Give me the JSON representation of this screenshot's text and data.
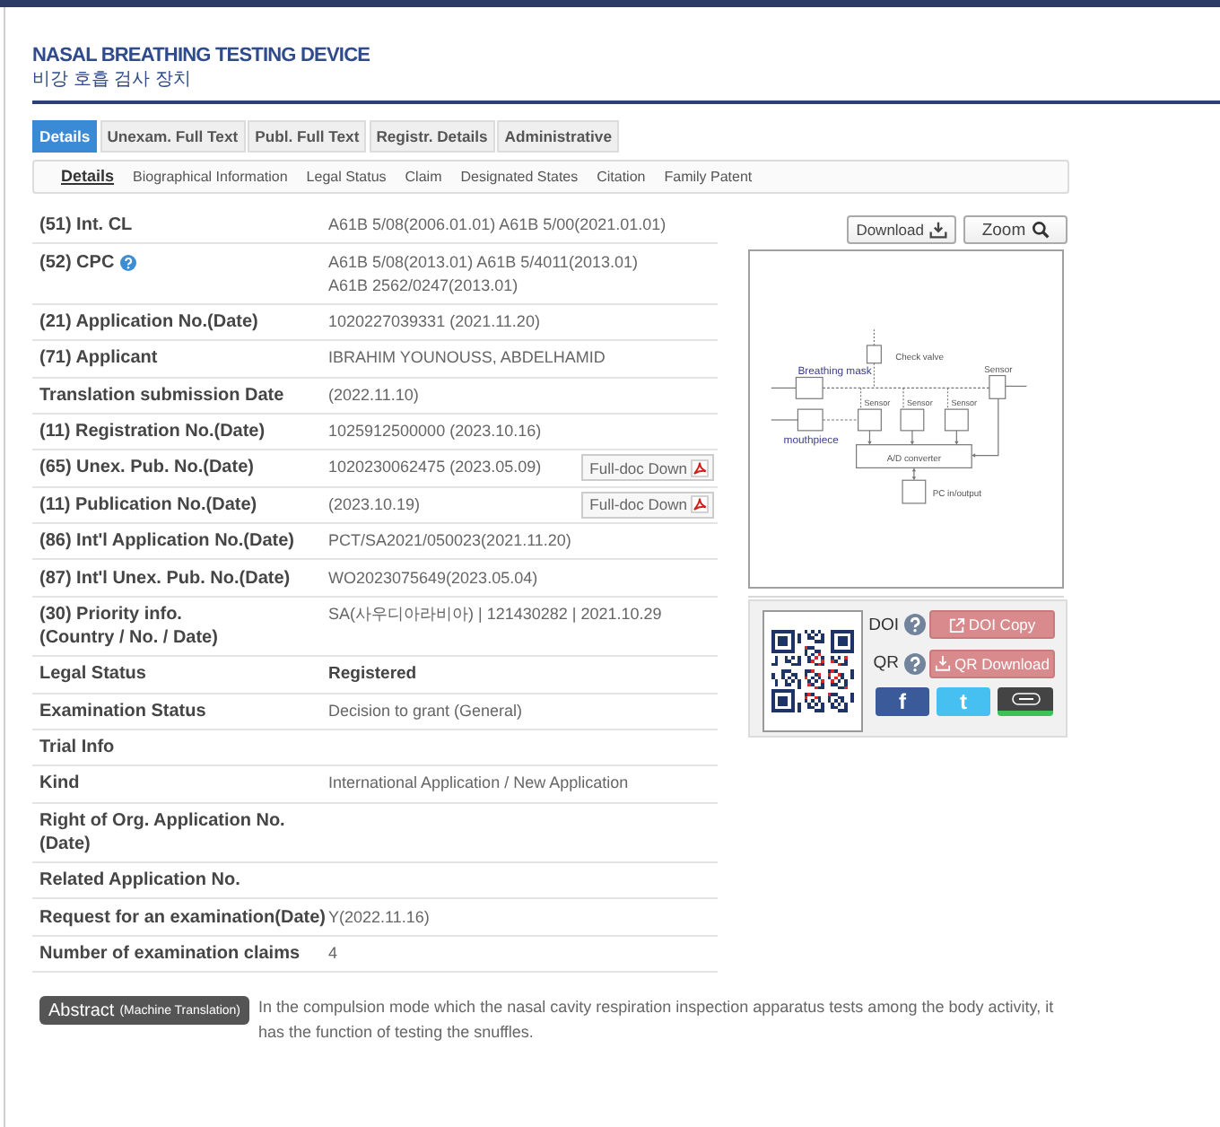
{
  "header": {
    "title": "NASAL BREATHING TESTING DEVICE",
    "subtitle": "비강 호흡 검사 장치"
  },
  "tabs": [
    {
      "label": "Details",
      "selected": true
    },
    {
      "label": "Unexam. Full Text",
      "selected": false
    },
    {
      "label": "Publ. Full Text",
      "selected": false
    },
    {
      "label": "Registr. Details",
      "selected": false
    },
    {
      "label": "Administrative",
      "selected": false
    }
  ],
  "subtabs": [
    {
      "label": "Details",
      "selected": true
    },
    {
      "label": "Biographical Information",
      "selected": false
    },
    {
      "label": "Legal Status",
      "selected": false
    },
    {
      "label": "Claim",
      "selected": false
    },
    {
      "label": "Designated States",
      "selected": false
    },
    {
      "label": "Citation",
      "selected": false
    },
    {
      "label": "Family Patent",
      "selected": false
    }
  ],
  "fields": [
    {
      "kind": "plain",
      "label": "(51) Int. CL",
      "value": "A61B 5/08(2006.01.01) A61B 5/00(2021.01.01)"
    },
    {
      "kind": "help",
      "label": "(52) CPC",
      "value": "A61B 5/08(2013.01) A61B 5/4011(2013.01)\nA61B 2562/0247(2013.01)"
    },
    {
      "kind": "plain",
      "label": "(21) Application No.(Date)",
      "value": "1020227039331 (2021.11.20)"
    },
    {
      "kind": "plain",
      "label": "(71) Applicant",
      "value": "IBRAHIM YOUNOUSS, ABDELHAMID"
    },
    {
      "kind": "plain",
      "label": "Translation submission Date",
      "value": "(2022.11.10)"
    },
    {
      "kind": "plain",
      "label": "(11) Registration No.(Date)",
      "value": "1025912500000 (2023.10.16)"
    },
    {
      "kind": "plain",
      "label": "(65) Unex. Pub. No.(Date)",
      "value": "1020230062475 (2023.05.09)",
      "action": "Full-doc Down"
    },
    {
      "kind": "plain",
      "label": "(11) Publication No.(Date)",
      "value": "(2023.10.19)",
      "action": "Full-doc Down"
    },
    {
      "kind": "plain",
      "label": "(86) Int'l Application No.(Date)",
      "value": "PCT/SA2021/050023(2021.11.20)"
    },
    {
      "kind": "plain",
      "label": "(87) Int'l Unex. Pub. No.(Date)",
      "value": "WO2023075649(2023.05.04)"
    },
    {
      "kind": "plain",
      "label": "(30) Priority info.\n(Country / No. / Date)",
      "value": "SA(사우디아라비아) | 121430282 | 2021.10.29"
    },
    {
      "kind": "status",
      "label": "Legal Status",
      "value": "Registered"
    },
    {
      "kind": "plain",
      "label": "Examination Status",
      "value": "Decision to grant (General)"
    },
    {
      "kind": "plain",
      "label": "Trial Info"
    },
    {
      "kind": "plain",
      "label": "Kind",
      "value": "International Application / New Application"
    },
    {
      "kind": "plain",
      "label": "Right of Org. Application No.\n(Date)"
    },
    {
      "kind": "plain",
      "label": "Related Application No."
    },
    {
      "kind": "plain",
      "label": "Request for an examination(Date)",
      "value": "Y(2022.11.16)"
    },
    {
      "kind": "plain",
      "label": "Number of examination claims",
      "value": "4"
    }
  ],
  "image_tools": [
    {
      "kind": "download",
      "label": "Download"
    },
    {
      "kind": "zoom",
      "label": "Zoom"
    }
  ],
  "figure": {
    "labels": [
      "Check valve",
      "Breathing mask",
      "Sensor",
      "Sensor",
      "Sensor",
      "Sensor",
      "mouthpiece",
      "A/D converter",
      "PC in/output"
    ]
  },
  "share": {
    "rows": [
      {
        "kind": "copy",
        "label": "DOI",
        "button": "DOI Copy"
      },
      {
        "kind": "download",
        "label": "QR",
        "button": "QR Download"
      }
    ],
    "social": [
      {
        "kind": "facebook",
        "glyph": "f"
      },
      {
        "kind": "twitter",
        "glyph": "t"
      },
      {
        "kind": "band"
      }
    ]
  },
  "abstract": {
    "badge": "Abstract",
    "note": "(Machine Translation)",
    "text": "In the compulsion mode which the nasal cavity respiration inspection apparatus tests among the body activity, it has the function of testing the snuffles."
  }
}
